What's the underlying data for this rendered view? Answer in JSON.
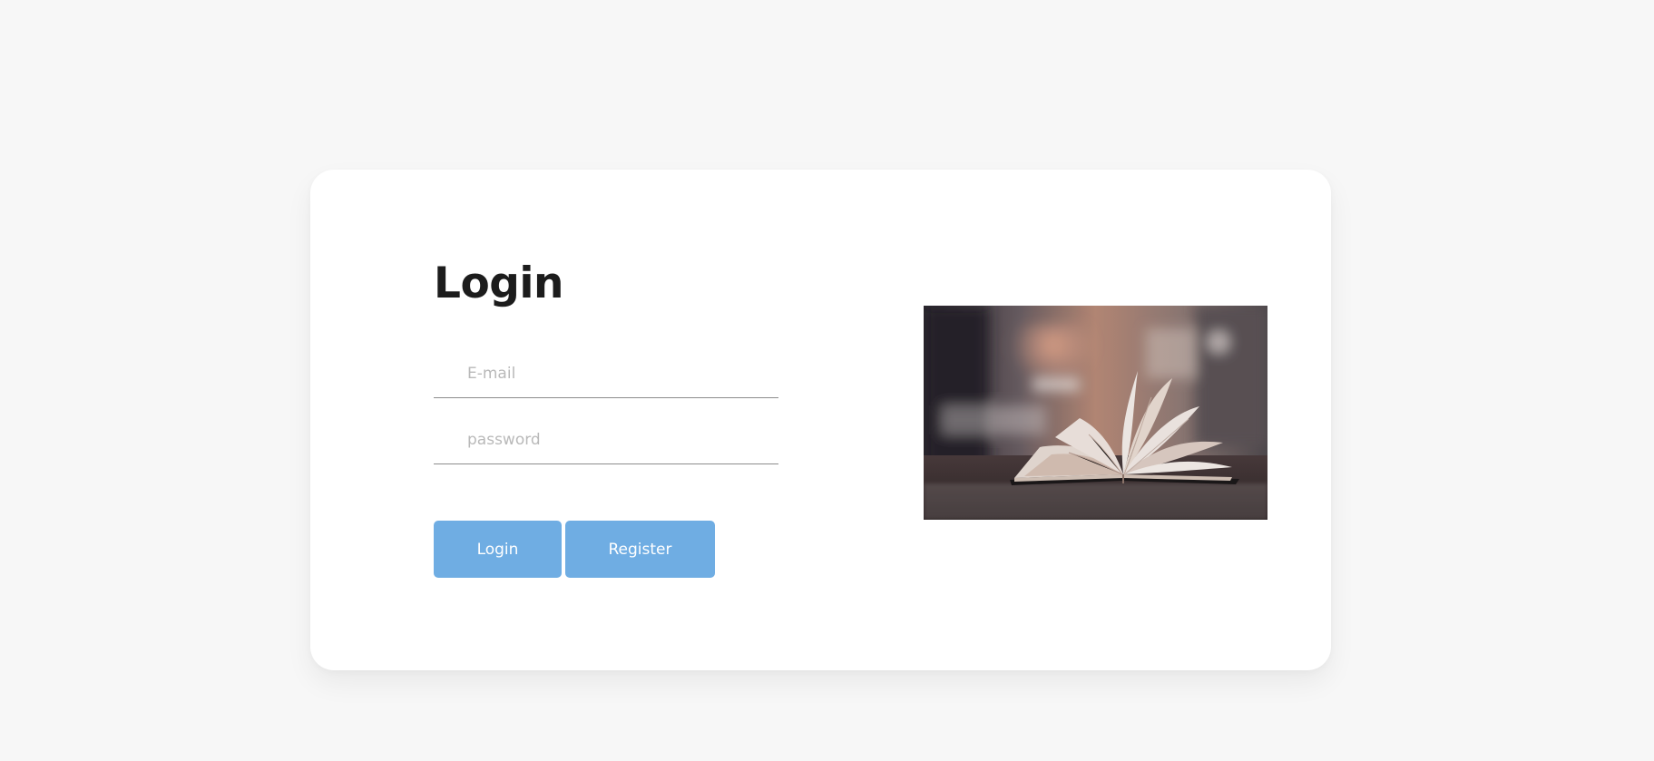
{
  "login": {
    "title": "Login",
    "email_placeholder": "E-mail",
    "password_placeholder": "password",
    "login_button_label": "Login",
    "register_button_label": "Register"
  },
  "colors": {
    "background": "#f7f7f7",
    "card": "#ffffff",
    "button": "#6fade3",
    "title_text": "#1c1c1c",
    "placeholder": "#b9b9b9",
    "underline": "#8c8c8c"
  },
  "image": {
    "semantic": "open-book-photo"
  }
}
